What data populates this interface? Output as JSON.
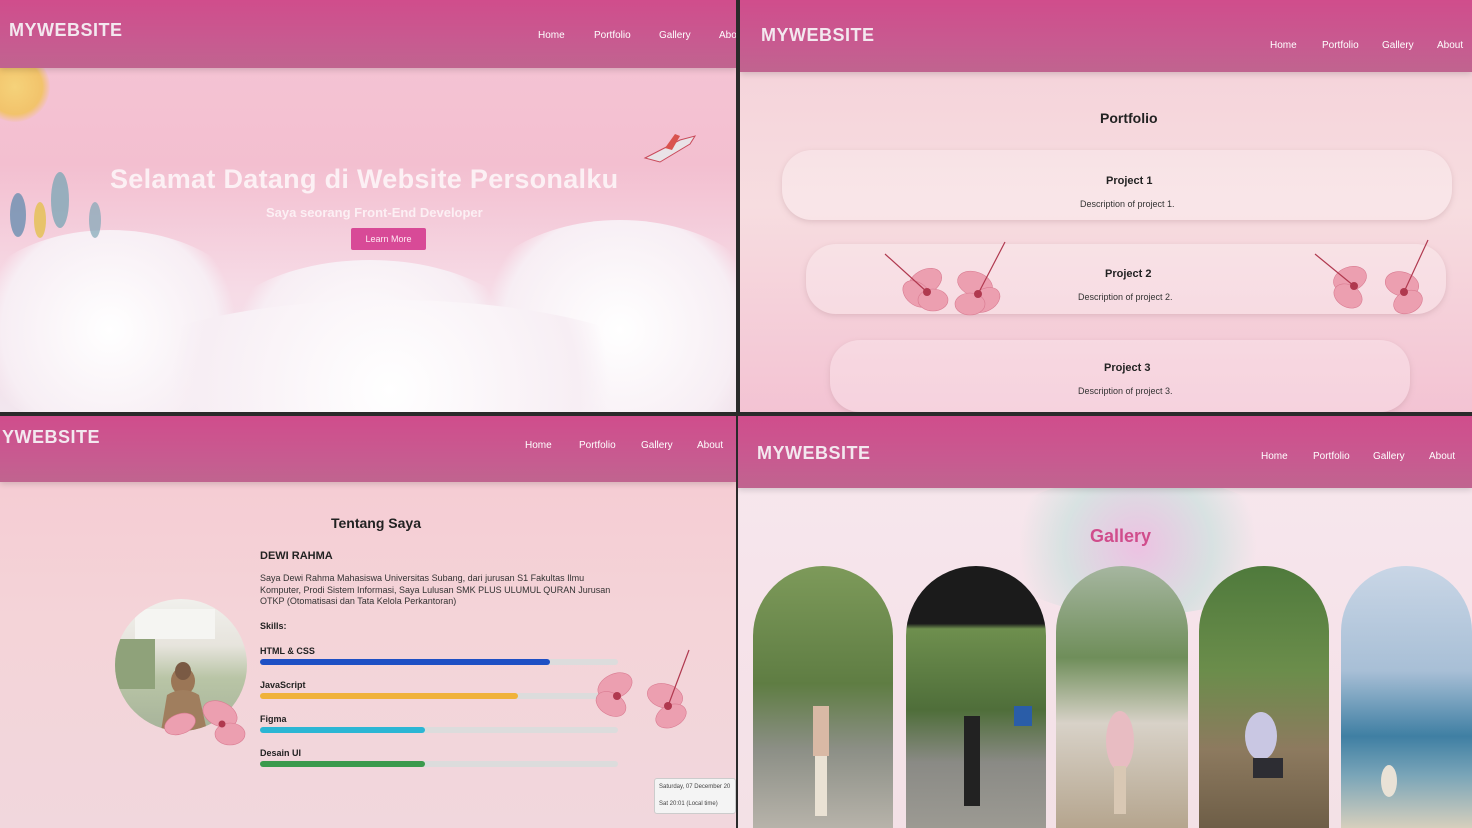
{
  "nav": {
    "logo": "MYWEBSITE",
    "logo_cut": "YWEBSITE",
    "links": [
      "Home",
      "Portfolio",
      "Gallery",
      "About"
    ],
    "about_cut": "Abo"
  },
  "hero": {
    "title": "Selamat Datang di Website Personalku",
    "subtitle": "Saya seorang Front-End Developer",
    "button": "Learn More"
  },
  "portfolio": {
    "title": "Portfolio",
    "projects": [
      {
        "name": "Project 1",
        "desc": "Description of project 1."
      },
      {
        "name": "Project 2",
        "desc": "Description of project 2."
      },
      {
        "name": "Project 3",
        "desc": "Description of project 3."
      }
    ]
  },
  "about": {
    "title": "Tentang Saya",
    "name": "DEWI RAHMA",
    "bio": "Saya Dewi Rahma Mahasiswa Universitas Subang, dari jurusan S1 Fakultas Ilmu Komputer, Prodi Sistem Informasi, Saya Lulusan SMK PLUS ULUMUL QURAN Jurusan OTKP (Otomatisasi dan Tata Kelola Perkantoran)",
    "skills_label": "Skills:",
    "skills": [
      {
        "name": "HTML & CSS",
        "level": 0.81,
        "color": "#1e4fc4"
      },
      {
        "name": "JavaScript",
        "level": 0.72,
        "color": "#f0b23a"
      },
      {
        "name": "Figma",
        "level": 0.46,
        "color": "#2bb6d4"
      },
      {
        "name": "Desain UI",
        "level": 0.46,
        "color": "#3b9a4c"
      }
    ]
  },
  "gallery": {
    "title": "Gallery"
  },
  "clock": {
    "date": "Saturday, 07 December 20",
    "time": "Sat 20:01 (Local time)"
  },
  "colors": {
    "nav": "#c85a90",
    "accent": "#d84a97",
    "gallery_title": "#d04d8c"
  }
}
